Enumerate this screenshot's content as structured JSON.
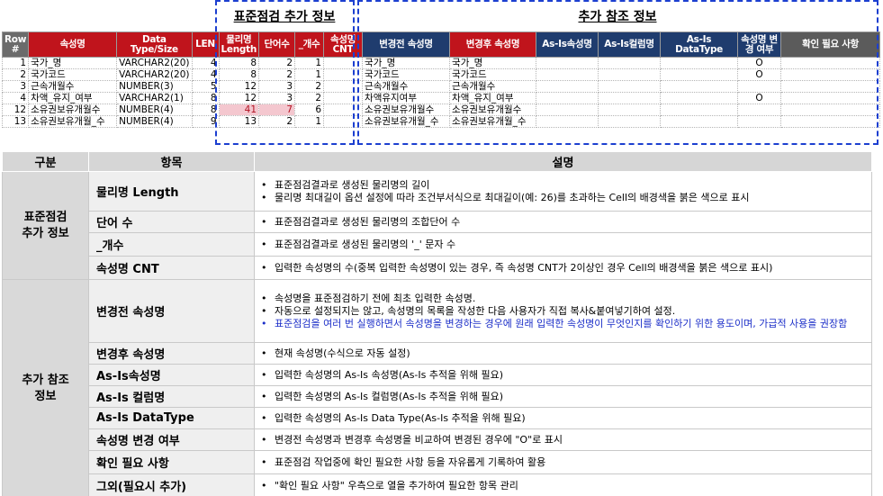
{
  "groups": {
    "standard_extra": "표준점검 추가 정보",
    "extra_reference": "추가 참조 정보"
  },
  "sheet": {
    "headers": [
      "Row #",
      "속성명",
      "Data Type/Size",
      "LEN",
      "물리명 Length",
      "단어수",
      "_개수",
      "속성명 CNT",
      "변경전 속성명",
      "변경후 속성명",
      "As-Is속성명",
      "As-Is컬럼명",
      "As-Is DataType",
      "속성명 변경 여부",
      "확인 필요 사항"
    ],
    "rows": [
      {
        "row": "1",
        "name": "국가_명",
        "type": "VARCHAR2(20)",
        "len": "4",
        "plen": "8",
        "words": "2",
        "cnt_": "1",
        "namecnt": "",
        "before": "국가_명",
        "after": "국가_명",
        "asis_name": "",
        "asis_col": "",
        "asis_type": "",
        "changed": "O",
        "note": "",
        "pink": false
      },
      {
        "row": "2",
        "name": "국가코드",
        "type": "VARCHAR2(20)",
        "len": "4",
        "plen": "8",
        "words": "2",
        "cnt_": "1",
        "namecnt": "",
        "before": "국가코드",
        "after": "국가코드",
        "asis_name": "",
        "asis_col": "",
        "asis_type": "",
        "changed": "O",
        "note": "",
        "pink": false
      },
      {
        "row": "3",
        "name": "근속개월수",
        "type": "NUMBER(3)",
        "len": "5",
        "plen": "12",
        "words": "3",
        "cnt_": "2",
        "namecnt": "",
        "before": "근속개월수",
        "after": "근속개월수",
        "asis_name": "",
        "asis_col": "",
        "asis_type": "",
        "changed": "",
        "note": "",
        "pink": false
      },
      {
        "row": "4",
        "name": "차액_유지_여부",
        "type": "VARCHAR2(1)",
        "len": "8",
        "plen": "12",
        "words": "3",
        "cnt_": "2",
        "namecnt": "",
        "before": "차액유지여부",
        "after": "차액_유지_여부",
        "asis_name": "",
        "asis_col": "",
        "asis_type": "",
        "changed": "O",
        "note": "",
        "pink": false
      },
      {
        "row": "12",
        "name": "소유권보유개월수",
        "type": "NUMBER(4)",
        "len": "8",
        "plen": "41",
        "words": "7",
        "cnt_": "6",
        "namecnt": "",
        "before": "소유권보유개월수",
        "after": "소유권보유개월수",
        "asis_name": "",
        "asis_col": "",
        "asis_type": "",
        "changed": "",
        "note": "",
        "pink": true
      },
      {
        "row": "13",
        "name": "소유권보유개월_수",
        "type": "NUMBER(4)",
        "len": "9",
        "plen": "13",
        "words": "2",
        "cnt_": "1",
        "namecnt": "",
        "before": "소유권보유개월_수",
        "after": "소유권보유개월_수",
        "asis_name": "",
        "asis_col": "",
        "asis_type": "",
        "changed": "",
        "note": "",
        "pink": false
      }
    ]
  },
  "desc": {
    "headers": {
      "category": "구분",
      "item": "항목",
      "description": "설명"
    },
    "cat1": "표준점검\n추가 정보",
    "cat2": "추가 참조\n정보",
    "rows": [
      {
        "item": "물리명 Length",
        "lines": [
          "표준점검결과로 생성된 물리명의 길이",
          "물리명 최대길이 옵션 설정에 따라 조건부서식으로 최대길이(예: 26)를 초과하는 Cell의 배경색을 붉은 색으로 표시"
        ]
      },
      {
        "item": "단어 수",
        "lines": [
          "표준점검결과로 생성된 물리명의 조합단어 수"
        ]
      },
      {
        "item": "_개수",
        "lines": [
          "표준점검결과로 생성된 물리명의 '_' 문자 수"
        ]
      },
      {
        "item": "속성명 CNT",
        "lines": [
          "입력한 속성명의 수(중복 입력한 속성명이 있는 경우, 즉 속성명 CNT가 2이상인 경우 Cell의 배경색을 붉은 색으로 표시)"
        ]
      },
      {
        "item": "변경전 속성명",
        "lines": [
          "속성명을 표준점검하기 전에 최초 입력한 속성명.",
          "자동으로 설정되지는 않고, 속성명의 목록을 작성한 다음 사용자가 직접 복사&붙여넣기하여 설정.",
          "표준점검을 여러 번 실행하면서 속성명을 변경하는 경우에 원래 입력한 속성명이 무엇인지를 확인하기 위한 용도이며, 가급적 사용을 권장함"
        ]
      },
      {
        "item": "변경후 속성명",
        "lines": [
          "현재 속성명(수식으로 자동 설정)"
        ]
      },
      {
        "item": "As-Is속성명",
        "lines": [
          "입력한 속성명의 As-Is 속성명(As-Is 추적을 위해 필요)"
        ]
      },
      {
        "item": "As-Is 컬럼명",
        "lines": [
          "입력한 속성명의 As-Is 컬럼명(As-Is 추적을 위해 필요)"
        ]
      },
      {
        "item": "As-Is DataType",
        "lines": [
          "입력한 속성명의 As-Is Data Type(As-Is 추적을 위해 필요)"
        ]
      },
      {
        "item": "속성명 변경 여부",
        "lines": [
          "변경전 속성명과 변경후 속성명을 비교하여 변경된 경우에 \"O\"로 표시"
        ]
      },
      {
        "item": "확인 필요 사항",
        "lines": [
          "표준점검 작업중에 확인 필요한 사항 등을 자유롭게 기록하여 활용"
        ]
      },
      {
        "item": "그외(필요시 추가)",
        "lines": [
          "\"확인 필요 사항\" 우측으로 열을 추가하여 필요한 항목 관리"
        ]
      }
    ]
  }
}
